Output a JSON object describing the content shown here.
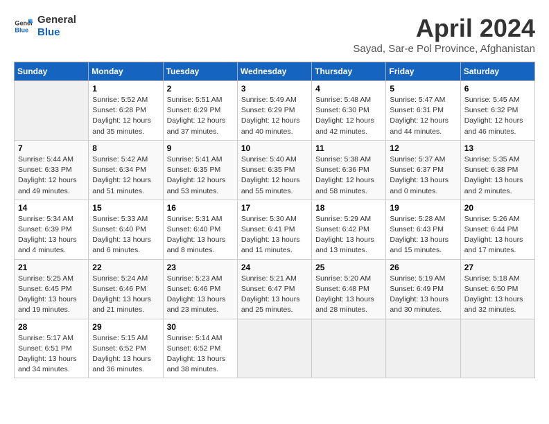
{
  "logo": {
    "line1": "General",
    "line2": "Blue"
  },
  "title": "April 2024",
  "subtitle": "Sayad, Sar-e Pol Province, Afghanistan",
  "days_header": [
    "Sunday",
    "Monday",
    "Tuesday",
    "Wednesday",
    "Thursday",
    "Friday",
    "Saturday"
  ],
  "weeks": [
    [
      {
        "day": "",
        "info": ""
      },
      {
        "day": "1",
        "info": "Sunrise: 5:52 AM\nSunset: 6:28 PM\nDaylight: 12 hours\nand 35 minutes."
      },
      {
        "day": "2",
        "info": "Sunrise: 5:51 AM\nSunset: 6:29 PM\nDaylight: 12 hours\nand 37 minutes."
      },
      {
        "day": "3",
        "info": "Sunrise: 5:49 AM\nSunset: 6:29 PM\nDaylight: 12 hours\nand 40 minutes."
      },
      {
        "day": "4",
        "info": "Sunrise: 5:48 AM\nSunset: 6:30 PM\nDaylight: 12 hours\nand 42 minutes."
      },
      {
        "day": "5",
        "info": "Sunrise: 5:47 AM\nSunset: 6:31 PM\nDaylight: 12 hours\nand 44 minutes."
      },
      {
        "day": "6",
        "info": "Sunrise: 5:45 AM\nSunset: 6:32 PM\nDaylight: 12 hours\nand 46 minutes."
      }
    ],
    [
      {
        "day": "7",
        "info": "Sunrise: 5:44 AM\nSunset: 6:33 PM\nDaylight: 12 hours\nand 49 minutes."
      },
      {
        "day": "8",
        "info": "Sunrise: 5:42 AM\nSunset: 6:34 PM\nDaylight: 12 hours\nand 51 minutes."
      },
      {
        "day": "9",
        "info": "Sunrise: 5:41 AM\nSunset: 6:35 PM\nDaylight: 12 hours\nand 53 minutes."
      },
      {
        "day": "10",
        "info": "Sunrise: 5:40 AM\nSunset: 6:35 PM\nDaylight: 12 hours\nand 55 minutes."
      },
      {
        "day": "11",
        "info": "Sunrise: 5:38 AM\nSunset: 6:36 PM\nDaylight: 12 hours\nand 58 minutes."
      },
      {
        "day": "12",
        "info": "Sunrise: 5:37 AM\nSunset: 6:37 PM\nDaylight: 13 hours\nand 0 minutes."
      },
      {
        "day": "13",
        "info": "Sunrise: 5:35 AM\nSunset: 6:38 PM\nDaylight: 13 hours\nand 2 minutes."
      }
    ],
    [
      {
        "day": "14",
        "info": "Sunrise: 5:34 AM\nSunset: 6:39 PM\nDaylight: 13 hours\nand 4 minutes."
      },
      {
        "day": "15",
        "info": "Sunrise: 5:33 AM\nSunset: 6:40 PM\nDaylight: 13 hours\nand 6 minutes."
      },
      {
        "day": "16",
        "info": "Sunrise: 5:31 AM\nSunset: 6:40 PM\nDaylight: 13 hours\nand 8 minutes."
      },
      {
        "day": "17",
        "info": "Sunrise: 5:30 AM\nSunset: 6:41 PM\nDaylight: 13 hours\nand 11 minutes."
      },
      {
        "day": "18",
        "info": "Sunrise: 5:29 AM\nSunset: 6:42 PM\nDaylight: 13 hours\nand 13 minutes."
      },
      {
        "day": "19",
        "info": "Sunrise: 5:28 AM\nSunset: 6:43 PM\nDaylight: 13 hours\nand 15 minutes."
      },
      {
        "day": "20",
        "info": "Sunrise: 5:26 AM\nSunset: 6:44 PM\nDaylight: 13 hours\nand 17 minutes."
      }
    ],
    [
      {
        "day": "21",
        "info": "Sunrise: 5:25 AM\nSunset: 6:45 PM\nDaylight: 13 hours\nand 19 minutes."
      },
      {
        "day": "22",
        "info": "Sunrise: 5:24 AM\nSunset: 6:46 PM\nDaylight: 13 hours\nand 21 minutes."
      },
      {
        "day": "23",
        "info": "Sunrise: 5:23 AM\nSunset: 6:46 PM\nDaylight: 13 hours\nand 23 minutes."
      },
      {
        "day": "24",
        "info": "Sunrise: 5:21 AM\nSunset: 6:47 PM\nDaylight: 13 hours\nand 25 minutes."
      },
      {
        "day": "25",
        "info": "Sunrise: 5:20 AM\nSunset: 6:48 PM\nDaylight: 13 hours\nand 28 minutes."
      },
      {
        "day": "26",
        "info": "Sunrise: 5:19 AM\nSunset: 6:49 PM\nDaylight: 13 hours\nand 30 minutes."
      },
      {
        "day": "27",
        "info": "Sunrise: 5:18 AM\nSunset: 6:50 PM\nDaylight: 13 hours\nand 32 minutes."
      }
    ],
    [
      {
        "day": "28",
        "info": "Sunrise: 5:17 AM\nSunset: 6:51 PM\nDaylight: 13 hours\nand 34 minutes."
      },
      {
        "day": "29",
        "info": "Sunrise: 5:15 AM\nSunset: 6:52 PM\nDaylight: 13 hours\nand 36 minutes."
      },
      {
        "day": "30",
        "info": "Sunrise: 5:14 AM\nSunset: 6:52 PM\nDaylight: 13 hours\nand 38 minutes."
      },
      {
        "day": "",
        "info": ""
      },
      {
        "day": "",
        "info": ""
      },
      {
        "day": "",
        "info": ""
      },
      {
        "day": "",
        "info": ""
      }
    ]
  ]
}
